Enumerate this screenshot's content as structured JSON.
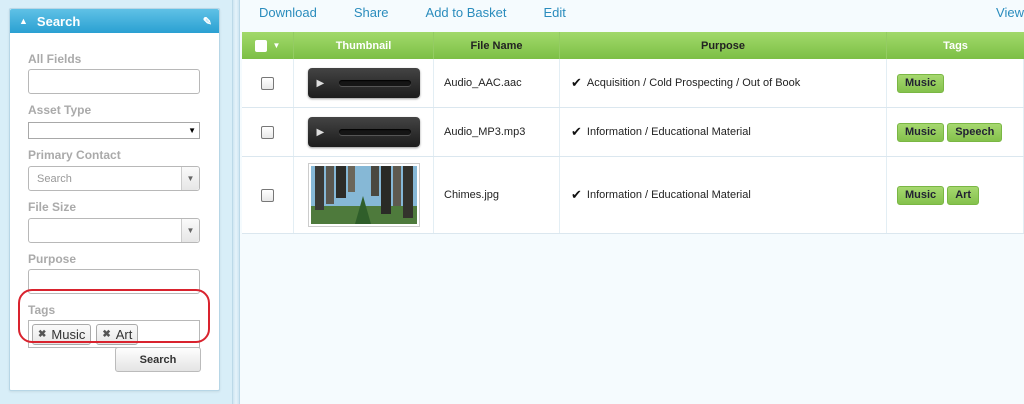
{
  "sidebar": {
    "header": {
      "title": "Search"
    },
    "fields": {
      "all_fields_label": "All Fields",
      "asset_type_label": "Asset Type",
      "primary_contact_label": "Primary Contact",
      "primary_contact_placeholder": "Search",
      "file_size_label": "File Size",
      "purpose_label": "Purpose",
      "tags_label": "Tags"
    },
    "selected_tags": [
      "Music",
      "Art"
    ],
    "search_button": "Search"
  },
  "toolbar": {
    "download": "Download",
    "share": "Share",
    "add_to_basket": "Add to Basket",
    "edit": "Edit",
    "view": "View"
  },
  "table": {
    "columns": [
      "Thumbnail",
      "File Name",
      "Purpose",
      "Tags"
    ],
    "rows": [
      {
        "file_name": "Audio_AAC.aac",
        "purpose": "Acquisition / Cold Prospecting / Out of Book",
        "tags": [
          "Music"
        ],
        "thumbnail": "audio-player"
      },
      {
        "file_name": "Audio_MP3.mp3",
        "purpose": "Information / Educational Material",
        "tags": [
          "Music",
          "Speech"
        ],
        "thumbnail": "audio-player"
      },
      {
        "file_name": "Chimes.jpg",
        "purpose": "Information / Educational Material",
        "tags": [
          "Music",
          "Art"
        ],
        "thumbnail": "image"
      }
    ]
  },
  "colors": {
    "accent_blue": "#2aa0d2",
    "header_green": "#7cbf45",
    "highlight_red": "#d9232e",
    "link_blue": "#2a8cbd"
  }
}
